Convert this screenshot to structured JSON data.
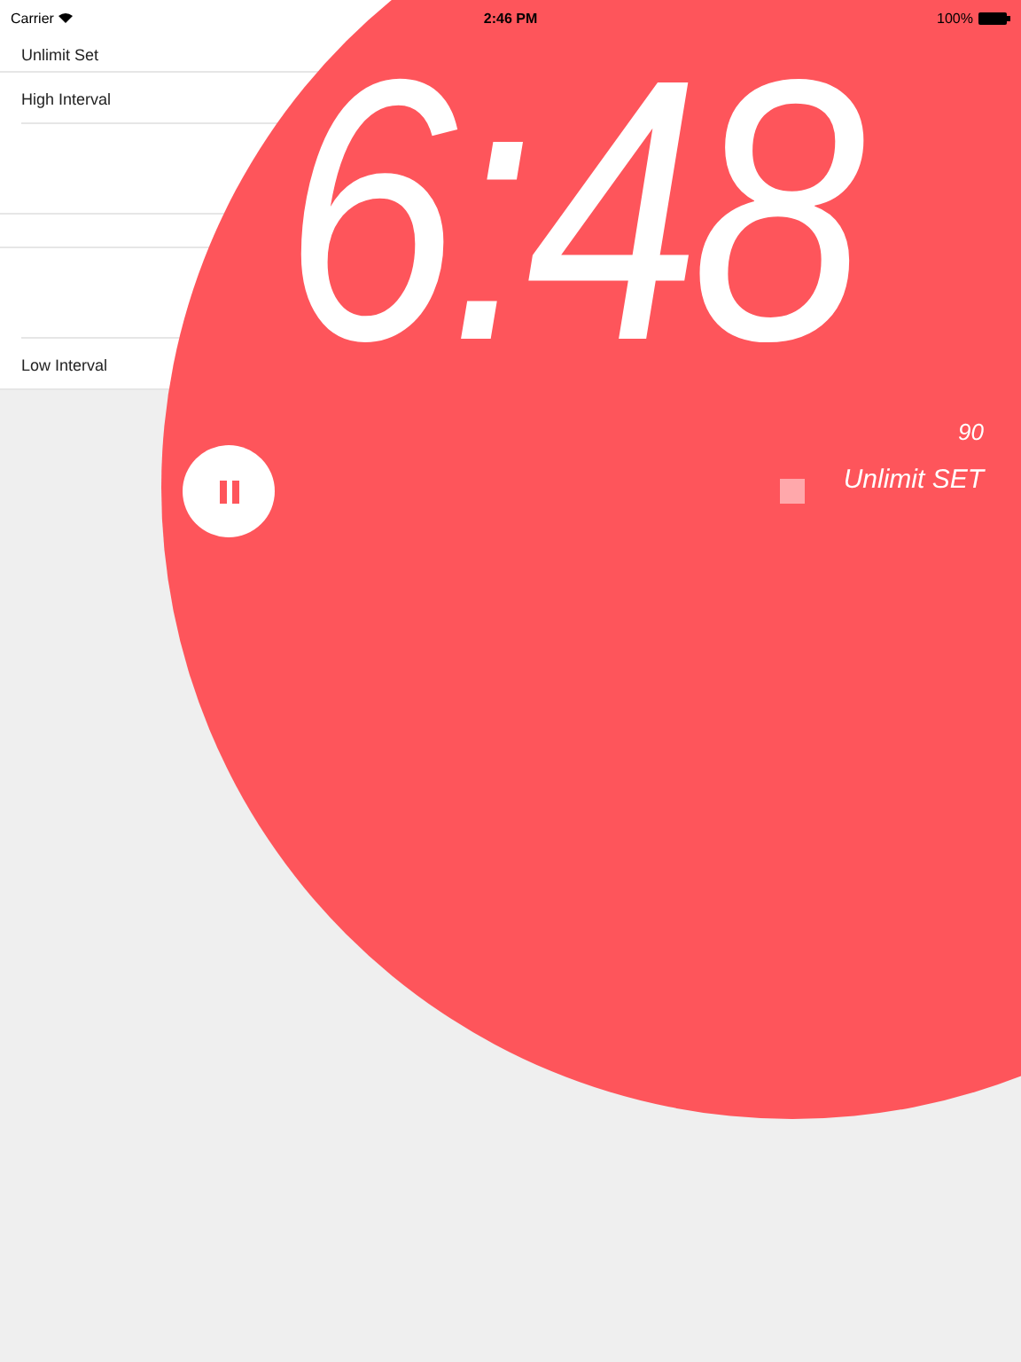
{
  "status_bar": {
    "carrier": "Carrier",
    "time": "2:46 PM",
    "battery": "100%"
  },
  "settings_list": [
    {
      "kind": "row",
      "label": "Unlimit Set",
      "inset_divider": false
    },
    {
      "kind": "row",
      "label": "High Interval",
      "inset_divider": true
    },
    {
      "kind": "blank",
      "inset_divider": false
    },
    {
      "kind": "gap",
      "inset_divider": false
    },
    {
      "kind": "blank",
      "inset_divider": true
    },
    {
      "kind": "row",
      "label": "Low Interval",
      "inset_divider": false
    }
  ],
  "timer": {
    "time": "6:48",
    "count": "90",
    "mode": "Unlimit SET"
  }
}
